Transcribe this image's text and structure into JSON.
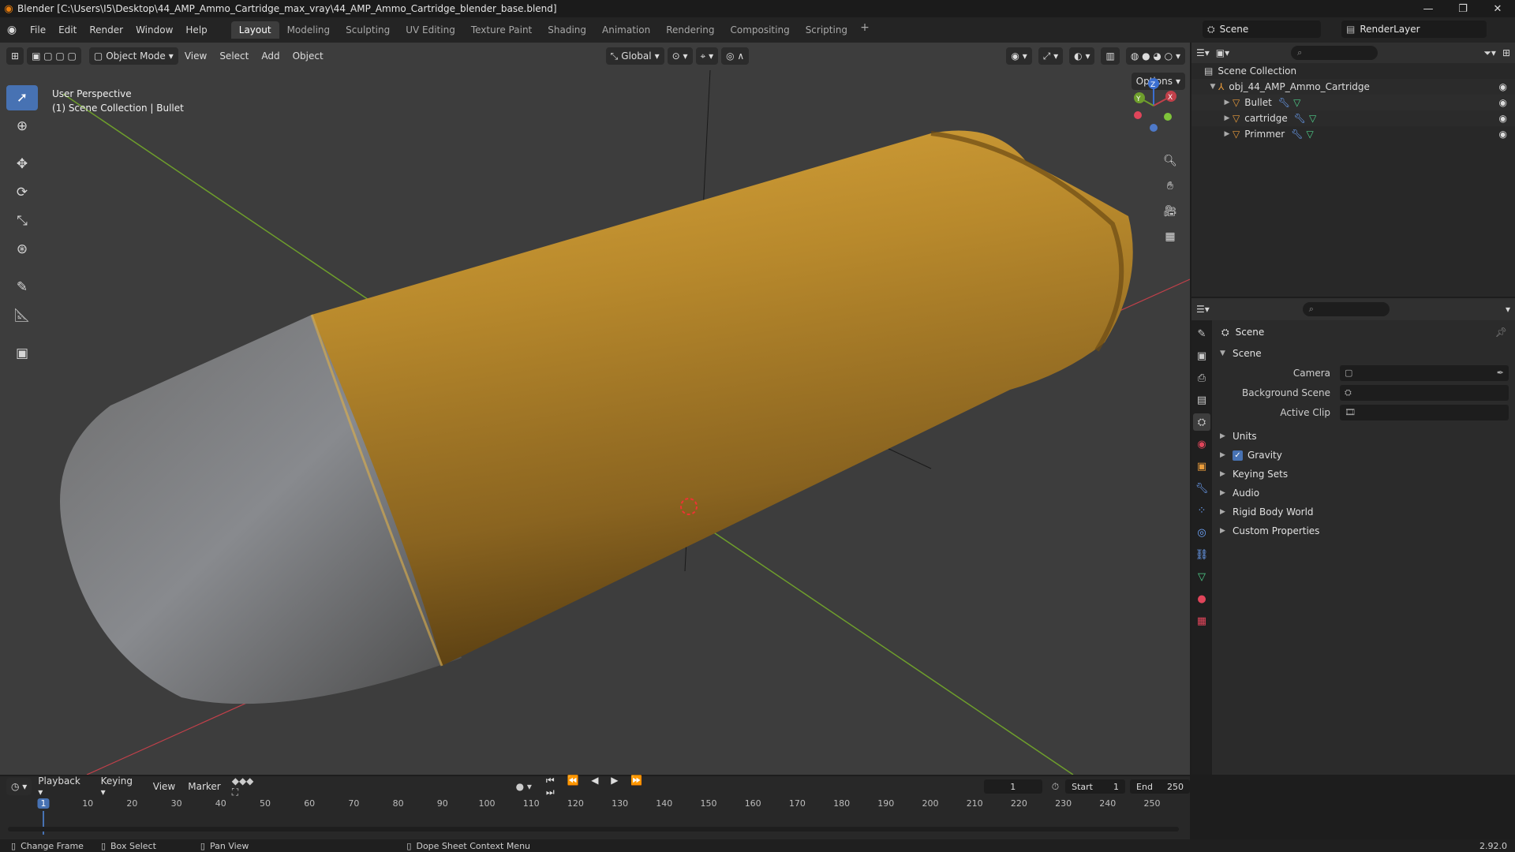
{
  "window": {
    "title": "Blender [C:\\Users\\I5\\Desktop\\44_AMP_Ammo_Cartridge_max_vray\\44_AMP_Ammo_Cartridge_blender_base.blend]"
  },
  "menu": [
    "File",
    "Edit",
    "Render",
    "Window",
    "Help"
  ],
  "workspaces": [
    "Layout",
    "Modeling",
    "Sculpting",
    "UV Editing",
    "Texture Paint",
    "Shading",
    "Animation",
    "Rendering",
    "Compositing",
    "Scripting"
  ],
  "active_workspace": "Layout",
  "scene_name": "Scene",
  "render_layer": "RenderLayer",
  "viewport": {
    "mode": "Object Mode",
    "header_menus": [
      "View",
      "Select",
      "Add",
      "Object"
    ],
    "orientation": "Global",
    "options_label": "Options",
    "info_line1": "User Perspective",
    "info_line2": "(1) Scene Collection | Bullet",
    "gizmo_axes": [
      "X",
      "Y",
      "Z"
    ]
  },
  "outliner": {
    "root": "Scene Collection",
    "collection": "obj_44_AMP_Ammo_Cartridge",
    "objects": [
      "Bullet",
      "cartridge",
      "Primmer"
    ]
  },
  "properties": {
    "context": "Scene",
    "panel": "Scene",
    "fields": [
      {
        "label": "Camera"
      },
      {
        "label": "Background Scene"
      },
      {
        "label": "Active Clip"
      }
    ],
    "subpanels": [
      "Units",
      "Gravity",
      "Keying Sets",
      "Audio",
      "Rigid Body World",
      "Custom Properties"
    ],
    "gravity_checked": true
  },
  "timeline": {
    "menus": [
      "Playback",
      "Keying",
      "View",
      "Marker"
    ],
    "current_frame": "1",
    "start_label": "Start",
    "start": "1",
    "end_label": "End",
    "end": "250",
    "ruler": [
      "1",
      "10",
      "20",
      "30",
      "40",
      "50",
      "60",
      "70",
      "80",
      "90",
      "100",
      "110",
      "120",
      "130",
      "140",
      "150",
      "160",
      "170",
      "180",
      "190",
      "200",
      "210",
      "220",
      "230",
      "240",
      "250"
    ]
  },
  "statusbar": {
    "change_frame": "Change Frame",
    "box_select": "Box Select",
    "pan_view": "Pan View",
    "context_menu": "Dope Sheet Context Menu",
    "version": "2.92.0"
  },
  "colors": {
    "accent": "#4772b3",
    "brass": "#b8892c",
    "axis_x": "#c2404a",
    "axis_y": "#6e9e2c",
    "axis_z": "#3b6fd1"
  }
}
